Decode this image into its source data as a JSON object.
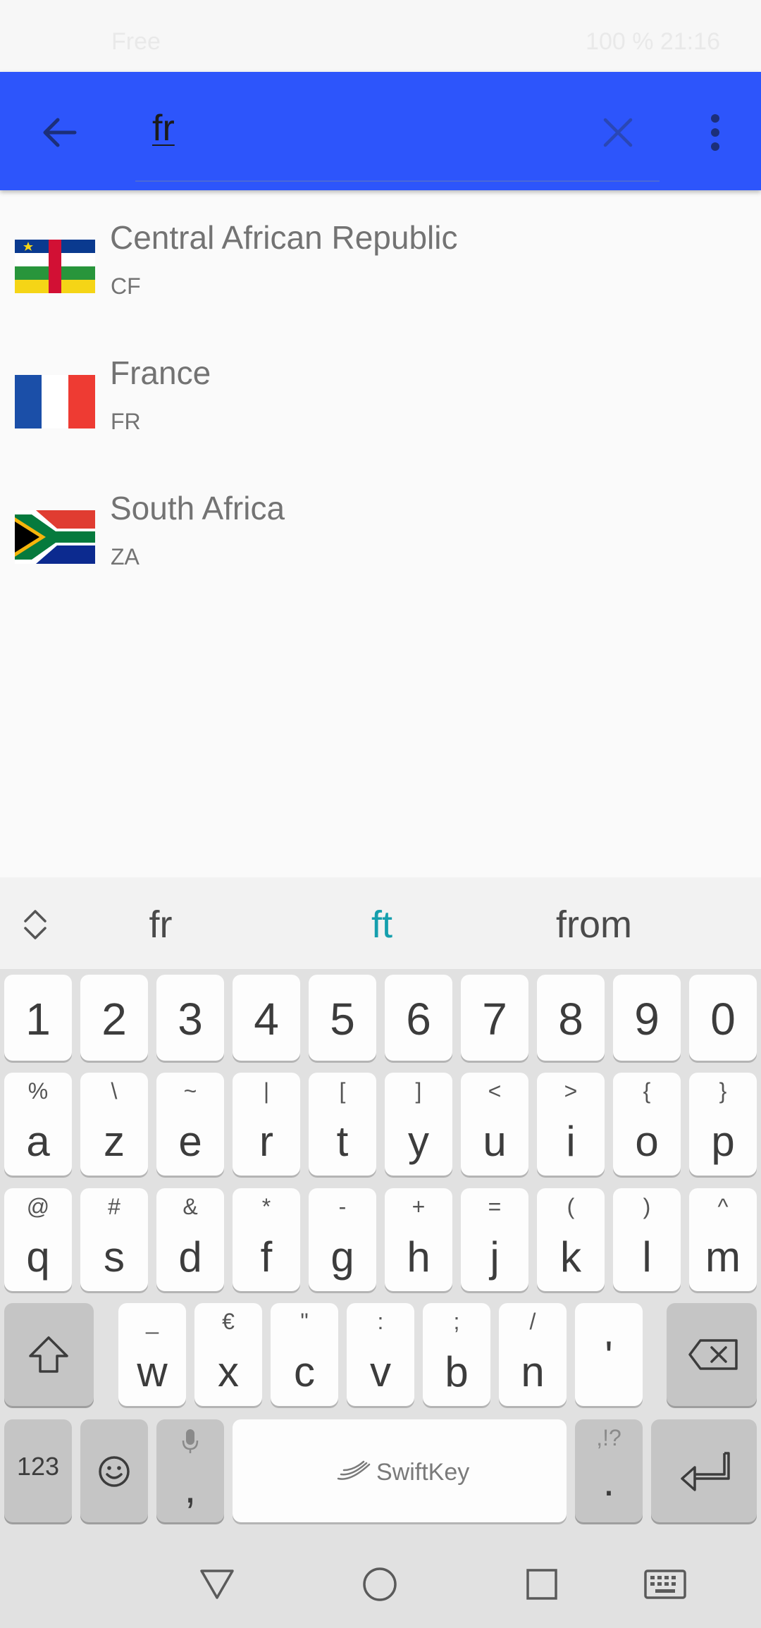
{
  "status_bar": {
    "left": "Free",
    "right": "100 %  21:16"
  },
  "search": {
    "query": "fr"
  },
  "countries": [
    {
      "name": "Central African Republic",
      "code": "CF",
      "flag": "flag-central-african-republic"
    },
    {
      "name": "France",
      "code": "FR",
      "flag": "flag-france"
    },
    {
      "name": "South Africa",
      "code": "ZA",
      "flag": "flag-south-africa"
    }
  ],
  "keyboard": {
    "suggestions": [
      "fr",
      "ft",
      "from"
    ],
    "digits": [
      "1",
      "2",
      "3",
      "4",
      "5",
      "6",
      "7",
      "8",
      "9",
      "0"
    ],
    "row1": [
      {
        "main": "a",
        "alt": "%"
      },
      {
        "main": "z",
        "alt": "\\"
      },
      {
        "main": "e",
        "alt": "~"
      },
      {
        "main": "r",
        "alt": "|"
      },
      {
        "main": "t",
        "alt": "["
      },
      {
        "main": "y",
        "alt": "]"
      },
      {
        "main": "u",
        "alt": "<"
      },
      {
        "main": "i",
        "alt": ">"
      },
      {
        "main": "o",
        "alt": "{"
      },
      {
        "main": "p",
        "alt": "}"
      }
    ],
    "row2": [
      {
        "main": "q",
        "alt": "@"
      },
      {
        "main": "s",
        "alt": "#"
      },
      {
        "main": "d",
        "alt": "&"
      },
      {
        "main": "f",
        "alt": "*"
      },
      {
        "main": "g",
        "alt": "-"
      },
      {
        "main": "h",
        "alt": "+"
      },
      {
        "main": "j",
        "alt": "="
      },
      {
        "main": "k",
        "alt": "("
      },
      {
        "main": "l",
        "alt": ")"
      },
      {
        "main": "m",
        "alt": "^"
      }
    ],
    "row3": [
      {
        "main": "w",
        "alt": "_"
      },
      {
        "main": "x",
        "alt": "€"
      },
      {
        "main": "c",
        "alt": "\""
      },
      {
        "main": "v",
        "alt": ":"
      },
      {
        "main": "b",
        "alt": ";"
      },
      {
        "main": "n",
        "alt": "/"
      },
      {
        "main": "'",
        "alt": ""
      }
    ],
    "numbers_label": "123",
    "comma": ",",
    "space_label": "SwiftKey",
    "period": ".",
    "period_alt": ",!?"
  },
  "colors": {
    "toolbar": "#2d55fb",
    "suggestion_highlight": "#159fad"
  }
}
